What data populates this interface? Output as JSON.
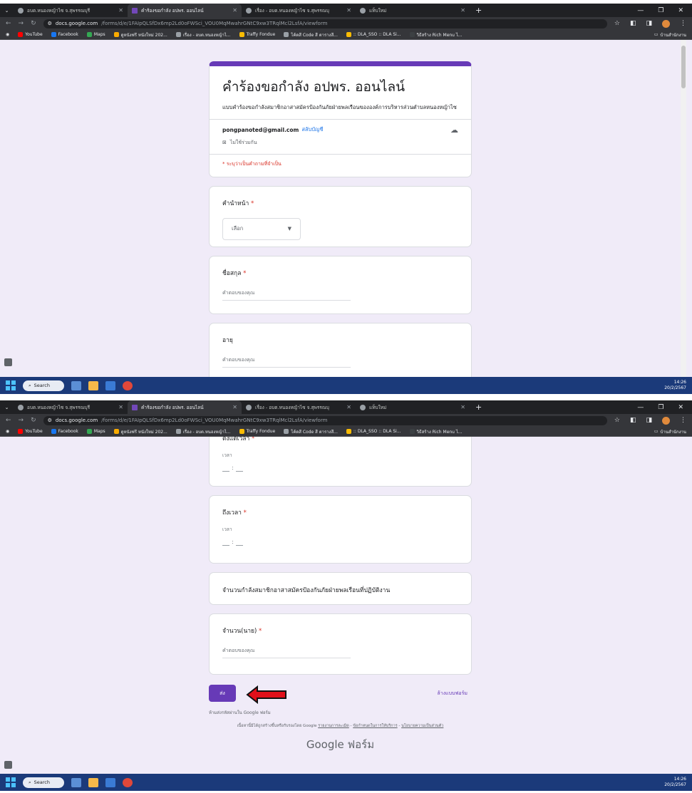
{
  "browser": {
    "tabs": [
      {
        "title": "อบต.หนองหญ้าไซ จ.สุพรรณบุรี",
        "active": false
      },
      {
        "title": "คำร้องขอกำลัง อปพร. ออนไลน์",
        "active": true
      },
      {
        "title": "เรื่อง - อบต.หนองหญ้าไซ จ.สุพรรณบุ",
        "active": false
      },
      {
        "title": "แท็บใหม่",
        "active": false
      }
    ],
    "url_host": "docs.google.com",
    "url_path": "/forms/d/e/1FAIpQLSfDx6mp2Ld0oFWSci_VOU0MqMwahrGNtC9xw3TRqlMcl2LsfA/viewform",
    "bookmarks": [
      {
        "label": "YouTube",
        "color": "#ff0000"
      },
      {
        "label": "Facebook",
        "color": "#1877f2"
      },
      {
        "label": "Maps",
        "color": "#34a853"
      },
      {
        "label": "ดูหนังฟรี หนังใหม่ 202...",
        "color": "#f9ab00"
      },
      {
        "label": "เรื่อง - อบต.หนองหญ้าไ...",
        "color": "#9aa0a6"
      },
      {
        "label": "Traffy Fondue",
        "color": "#fbbc04"
      },
      {
        "label": "โค้ดสี Code สี ตารางสี...",
        "color": "#9aa0a6"
      },
      {
        "label": ":: DLA_SSO :: DLA Si...",
        "color": "#fbbc04"
      },
      {
        "label": "วิธีสร้าง Rich Menu ไ...",
        "color": "#3c4043"
      }
    ],
    "bookmark_folder": "บ้านสำนักงาน"
  },
  "form": {
    "title": "คำร้องขอกำลัง อปพร. ออนไลน์",
    "description": "แบบคำร้องขอกำลังสมาชิกอาสาสมัครป้องกันภัยฝ่ายพลเรือนขององค์การบริหารส่วนตำบลหนองหญ้าไซ",
    "account_email": "pongpanoted@gmail.com",
    "switch_account": "สลับบัญชี",
    "not_shared": "ไม่ใช้ร่วมกัน",
    "required_note": "* ระบุว่าเป็นคำถามที่จำเป็น",
    "q_prefix_label": "คำนำหน้า",
    "q_prefix_placeholder": "เลือก",
    "q_surname_label": "ชื่อสกุล",
    "q_age_label": "อายุ",
    "answer_placeholder": "คำตอบของคุณ",
    "q_from_time_label": "ตั้งแต่เวลา",
    "time_caption": "เวลา",
    "time_sep": ":",
    "q_to_time_label": "ถึงเวลา",
    "section_title": "จำนวนกำลังสมาชิกอาสาสมัครป้องกันภัยฝ่ายพลเรือนที่ปฏิบัติงาน",
    "q_count_label": "จำนวน(นาย)",
    "required_star": "*",
    "submit_label": "ส่ง",
    "clear_label": "ล้างแบบฟอร์ม",
    "never_submit": "ห้ามส่งรหัสผ่านใน Google ฟอร์ม",
    "footer_prefix": "เนื้อหานี้มิได้ถูกสร้างขึ้นหรือรับรองโดย Google",
    "footer_links": [
      "รายงานการละเมิด",
      "ข้อกำหนดในการให้บริการ",
      "นโยบายความเป็นส่วนตัว"
    ],
    "brand_google": "Google",
    "brand_forms": "ฟอร์ม"
  },
  "taskbar": {
    "search_label": "Search",
    "time": "14:26",
    "date": "20/2/2567"
  },
  "colors": {
    "accent": "#673ab7",
    "form_bg": "#f0ebf8",
    "required": "#d93025",
    "arrow": "#e0101a"
  }
}
